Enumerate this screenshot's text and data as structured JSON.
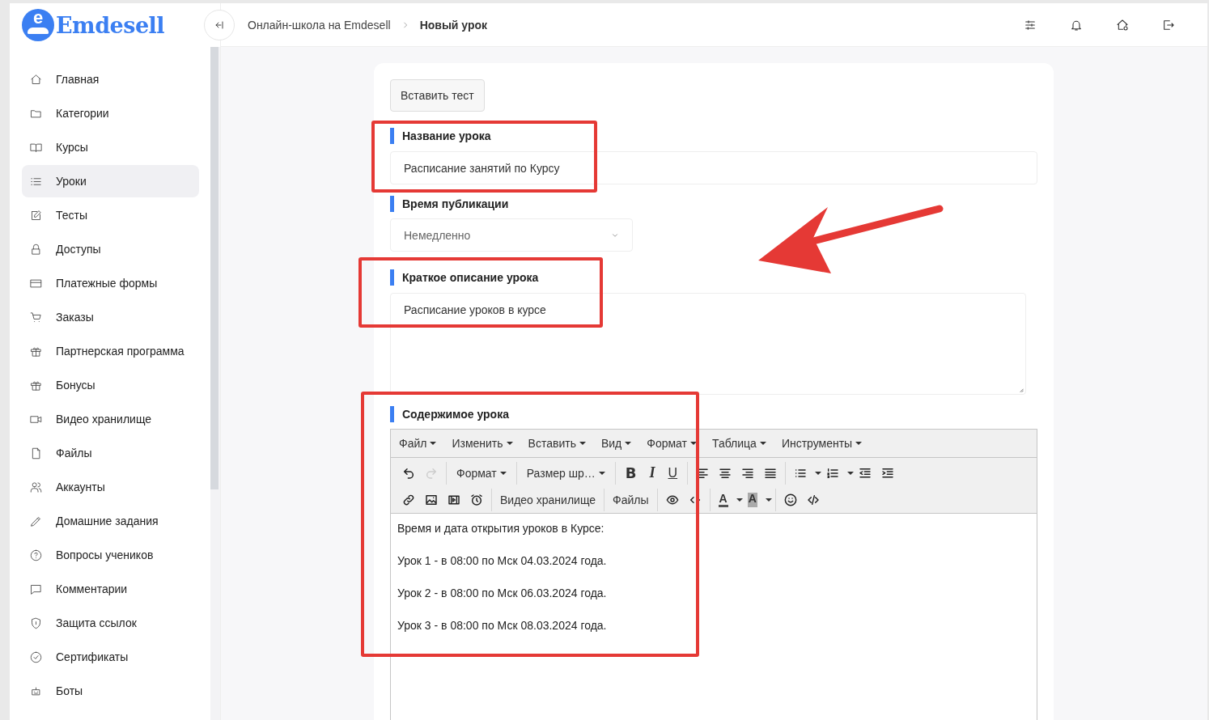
{
  "sidebar": {
    "logo": {
      "mark": "e",
      "name": "Emdesell"
    },
    "items": [
      {
        "label": "Главная",
        "selected": false
      },
      {
        "label": "Категории",
        "selected": false
      },
      {
        "label": "Курсы",
        "selected": false
      },
      {
        "label": "Уроки",
        "selected": true
      },
      {
        "label": "Тесты",
        "selected": false
      },
      {
        "label": "Доступы",
        "selected": false
      },
      {
        "label": "Платежные формы",
        "selected": false
      },
      {
        "label": "Заказы",
        "selected": false
      },
      {
        "label": "Партнерская программа",
        "selected": false
      },
      {
        "label": "Бонусы",
        "selected": false
      },
      {
        "label": "Видео хранилище",
        "selected": false
      },
      {
        "label": "Файлы",
        "selected": false
      },
      {
        "label": "Аккаунты",
        "selected": false
      },
      {
        "label": "Домашние задания",
        "selected": false
      },
      {
        "label": "Вопросы учеников",
        "selected": false
      },
      {
        "label": "Комментарии",
        "selected": false
      },
      {
        "label": "Защита ссылок",
        "selected": false
      },
      {
        "label": "Сертификаты",
        "selected": false
      },
      {
        "label": "Боты",
        "selected": false
      }
    ]
  },
  "header": {
    "breadcrumbs": [
      {
        "label": "Онлайн-школа на Emdesell",
        "current": false
      },
      {
        "label": "Новый урок",
        "current": true
      }
    ]
  },
  "form": {
    "insert_test_button": "Вставить тест",
    "arrow": true,
    "fields": [
      {
        "kind": "input",
        "label": "Название урока",
        "value": "Расписание занятий по Курсу",
        "highlighted": true
      },
      {
        "kind": "select",
        "label": "Время публикации",
        "value": "Немедленно",
        "highlighted": false
      },
      {
        "kind": "textarea",
        "label": "Краткое описание урока",
        "value": "Расписание уроков в курсе",
        "highlighted": true
      },
      {
        "kind": "editor",
        "label": "Содержимое урока",
        "highlighted": true
      }
    ]
  },
  "editor": {
    "menu": [
      "Файл",
      "Изменить",
      "Вставить",
      "Вид",
      "Формат",
      "Таблица",
      "Инструменты"
    ],
    "toolbar": [
      [
        [
          {
            "kind": "icon",
            "disabled": false
          },
          {
            "kind": "icon",
            "disabled": true
          }
        ],
        [
          {
            "kind": "dropdown",
            "label": "Формат",
            "disabled": false
          }
        ],
        [
          {
            "kind": "dropdown",
            "label": "Размер шр…",
            "disabled": false
          }
        ],
        [
          {
            "kind": "bold",
            "label": "B",
            "disabled": false
          },
          {
            "kind": "italic",
            "label": "I",
            "disabled": false
          },
          {
            "kind": "underline",
            "label": "U",
            "disabled": false
          }
        ],
        [
          {
            "kind": "icon",
            "disabled": false
          },
          {
            "kind": "icon",
            "disabled": false
          },
          {
            "kind": "icon",
            "disabled": false
          },
          {
            "kind": "icon",
            "disabled": false
          }
        ],
        [
          {
            "kind": "icon",
            "caret": true,
            "disabled": false
          },
          {
            "kind": "icon",
            "caret": true,
            "disabled": false
          },
          {
            "kind": "icon",
            "disabled": false
          },
          {
            "kind": "icon",
            "disabled": false
          }
        ]
      ],
      [
        [
          {
            "kind": "icon",
            "disabled": false
          },
          {
            "kind": "icon",
            "disabled": false
          },
          {
            "kind": "icon",
            "disabled": false
          },
          {
            "kind": "icon",
            "disabled": false
          }
        ],
        [
          {
            "kind": "text",
            "label": "Видео хранилище",
            "disabled": false
          }
        ],
        [
          {
            "kind": "text",
            "label": "Файлы",
            "disabled": false
          }
        ],
        [
          {
            "kind": "icon",
            "disabled": false
          },
          {
            "kind": "icon",
            "disabled": false
          }
        ],
        [
          {
            "kind": "forecolor",
            "label": "A",
            "caret": true,
            "disabled": false
          },
          {
            "kind": "backcolor",
            "label": "A",
            "caret": true,
            "disabled": false
          }
        ],
        [
          {
            "kind": "icon",
            "disabled": false
          },
          {
            "kind": "icon",
            "disabled": false
          }
        ]
      ]
    ],
    "paragraphs": [
      "Время и дата открытия уроков в Курсе:",
      "Урок 1 - в 08:00 по Мск 04.03.2024 года.",
      "Урок 2 - в 08:00 по Мск 06.03.2024 года.",
      "Урок 3 - в 08:00 по Мск 08.03.2024 года."
    ]
  }
}
